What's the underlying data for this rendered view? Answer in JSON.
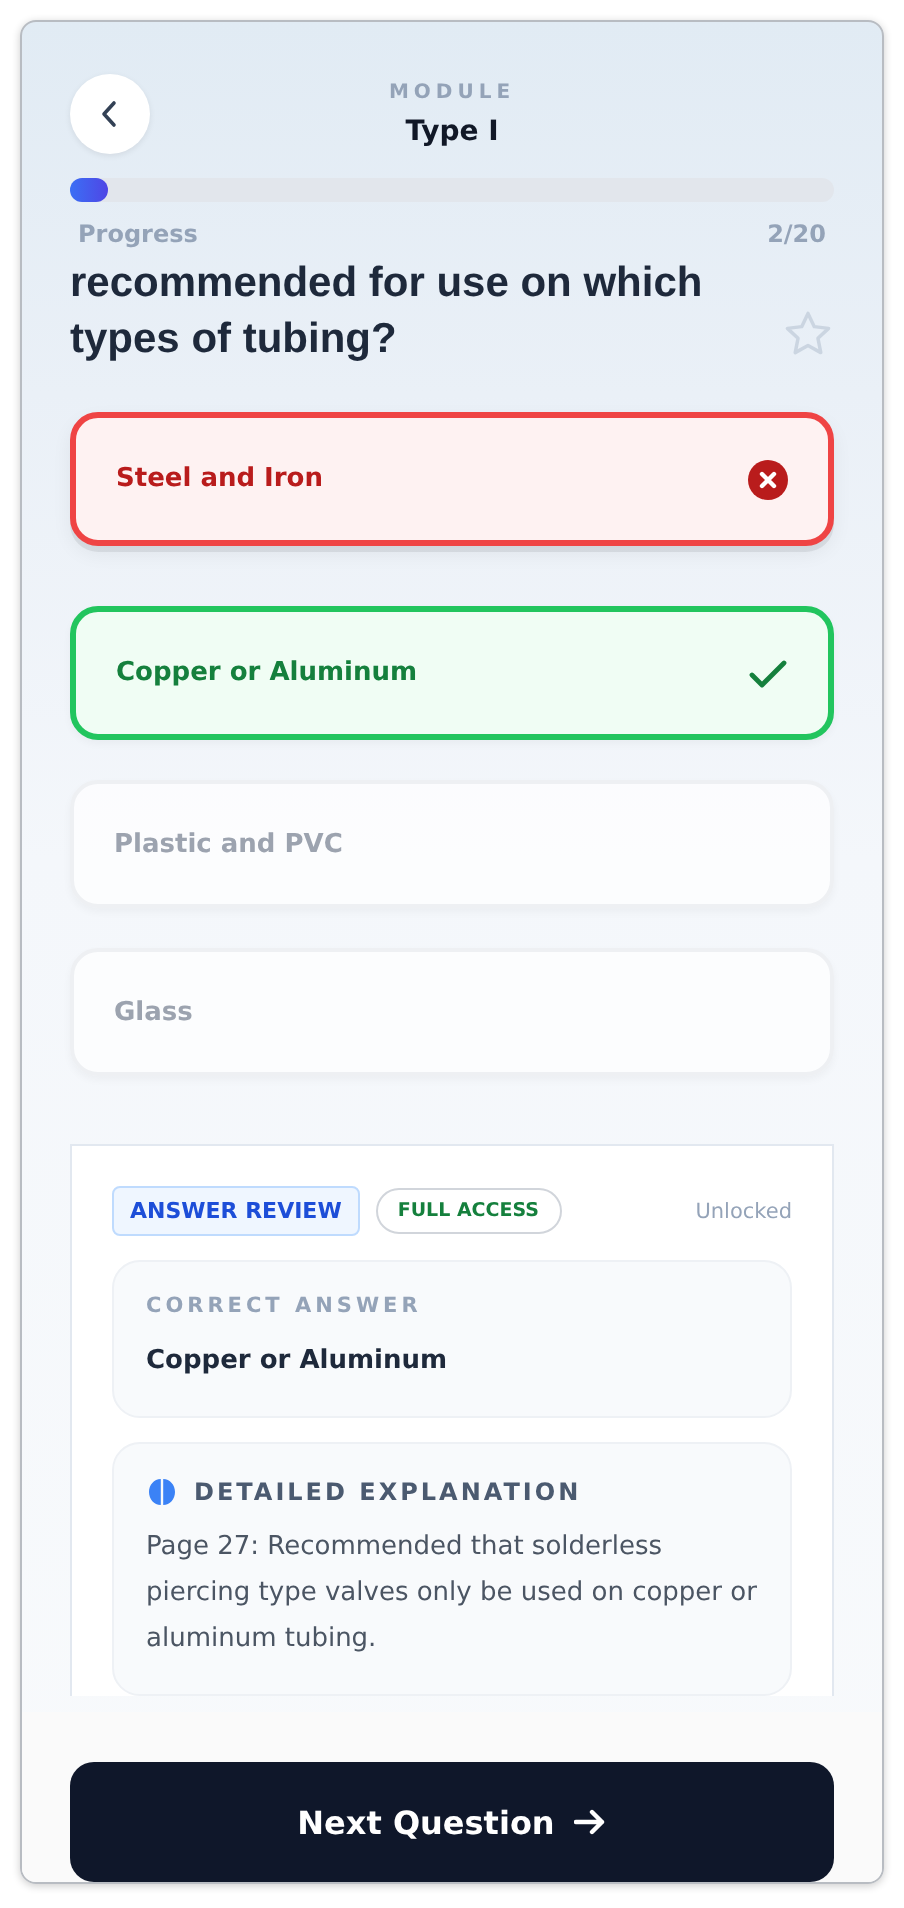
{
  "header": {
    "eyebrow": "MODULE",
    "title": "Type I"
  },
  "progress": {
    "label": "Progress",
    "count": "2/20",
    "level": 0.05
  },
  "question": {
    "text": "recommended for use on which types of tubing?",
    "starred": false
  },
  "options": [
    {
      "label": "Steel and Iron",
      "selected": true,
      "correct": false
    },
    {
      "label": "Copper or Aluminum",
      "selected": false,
      "correct": true
    },
    {
      "label": "Plastic and PVC",
      "selected": false,
      "correct": false
    },
    {
      "label": "Glass",
      "selected": false,
      "correct": false
    }
  ],
  "review": {
    "tag": "ANSWER REVIEW",
    "access": "FULL ACCESS",
    "status": "Unlocked",
    "correct_label": "CORRECT ANSWER",
    "correct_answer": "Copper or Aluminum",
    "explanation_label": "DETAILED EXPLANATION",
    "explanation": "Page 27: Recommended that solderless piercing type valves only be used on copper or aluminum tubing."
  },
  "next_button": "Next Question"
}
